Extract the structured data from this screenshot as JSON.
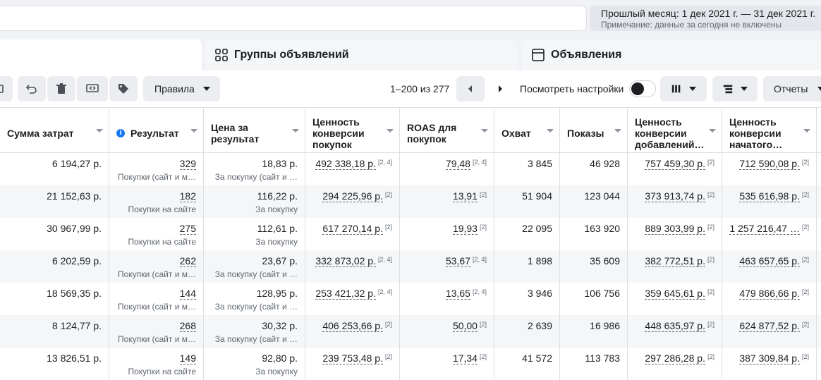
{
  "date_range": {
    "main": "Прошлый месяц: 1 дек 2021 г. — 31 дек 2021 г.",
    "note": "Примечание: данные за сегодня не включены"
  },
  "tabs": {
    "ad_groups": "Группы объявлений",
    "ads": "Объявления"
  },
  "toolbar": {
    "rules_label": "Правила",
    "pager_text": "1–200 из 277",
    "view_settings_label": "Посмотреть настройки",
    "reports_label": "Отчеты"
  },
  "columns": [
    "Сумма затрат",
    "Результат",
    "Цена за результат",
    "Ценность конверсии покупок",
    "ROAS для покупок",
    "Охват",
    "Показы",
    "Ценность конверсии добавлений…",
    "Ценность конверсии начатого…"
  ],
  "rows": [
    {
      "spend": "6 194,27 р.",
      "result": "329",
      "result_sub": "Покупки (сайт и м…",
      "cpr": "18,83 р.",
      "cpr_sub": "За покупку (сайт и …",
      "value": "492 338,18 р.",
      "value_sup": "[2, 4]",
      "roas": "79,48",
      "roas_sup": "[2, 4]",
      "reach": "3 845",
      "impr": "46 928",
      "add": "757 459,30 р.",
      "add_sup": "[2]",
      "init": "712 590,08 р.",
      "init_sup": "[2]"
    },
    {
      "spend": "21 152,63 р.",
      "result": "182",
      "result_sub": "Покупки на сайте",
      "cpr": "116,22 р.",
      "cpr_sub": "За покупку",
      "value": "294 225,96 р.",
      "value_sup": "[2]",
      "roas": "13,91",
      "roas_sup": "[2]",
      "reach": "51 904",
      "impr": "123 044",
      "add": "373 913,74 р.",
      "add_sup": "[2]",
      "init": "535 616,98 р.",
      "init_sup": "[2]"
    },
    {
      "spend": "30 967,99 р.",
      "result": "275",
      "result_sub": "Покупки на сайте",
      "cpr": "112,61 р.",
      "cpr_sub": "За покупку",
      "value": "617 270,14 р.",
      "value_sup": "[2]",
      "roas": "19,93",
      "roas_sup": "[2]",
      "reach": "22 095",
      "impr": "163 920",
      "add": "889 303,99 р.",
      "add_sup": "[2]",
      "init": "1 257 216,47 …",
      "init_sup": "[2]"
    },
    {
      "spend": "6 202,59 р.",
      "result": "262",
      "result_sub": "Покупки (сайт и м…",
      "cpr": "23,67 р.",
      "cpr_sub": "За покупку (сайт и …",
      "value": "332 873,02 р.",
      "value_sup": "[2, 4]",
      "roas": "53,67",
      "roas_sup": "[2, 4]",
      "reach": "1 898",
      "impr": "35 609",
      "add": "382 772,51 р.",
      "add_sup": "[2]",
      "init": "463 657,65 р.",
      "init_sup": "[2]"
    },
    {
      "spend": "18 569,35 р.",
      "result": "144",
      "result_sub": "Покупки (сайт и м…",
      "cpr": "128,95 р.",
      "cpr_sub": "За покупку (сайт и …",
      "value": "253 421,32 р.",
      "value_sup": "[2, 4]",
      "roas": "13,65",
      "roas_sup": "[2, 4]",
      "reach": "3 946",
      "impr": "106 756",
      "add": "359 645,61 р.",
      "add_sup": "[2]",
      "init": "479 866,66 р.",
      "init_sup": "[2]"
    },
    {
      "spend": "8 124,77 р.",
      "result": "268",
      "result_sub": "Покупки (сайт и м…",
      "cpr": "30,32 р.",
      "cpr_sub": "За покупку (сайт и …",
      "value": "406 253,66 р.",
      "value_sup": "[2]",
      "roas": "50,00",
      "roas_sup": "[2]",
      "reach": "2 639",
      "impr": "16 986",
      "add": "448 635,97 р.",
      "add_sup": "[2]",
      "init": "624 877,52 р.",
      "init_sup": "[2]"
    },
    {
      "spend": "13 826,51 р.",
      "result": "149",
      "result_sub": "Покупки на сайте",
      "cpr": "92,80 р.",
      "cpr_sub": "За покупку",
      "value": "239 753,48 р.",
      "value_sup": "[2]",
      "roas": "17,34",
      "roas_sup": "[2]",
      "reach": "41 572",
      "impr": "113 783",
      "add": "297 286,28 р.",
      "add_sup": "[2]",
      "init": "387 309,84 р.",
      "init_sup": "[2]"
    }
  ]
}
